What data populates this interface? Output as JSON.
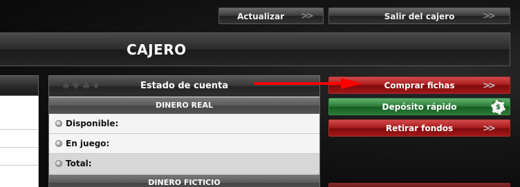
{
  "header": {
    "refresh_label": "Actualizar",
    "exit_label": "Salir del cajero",
    "arrow_glyph": ">>"
  },
  "title_bar": {
    "title": "CAJERO"
  },
  "account": {
    "heading": "Estado de cuenta",
    "heading_decoration": "♠♥♣♦",
    "real_money_section": "DINERO REAL",
    "rows": [
      {
        "label": "Disponible:"
      },
      {
        "label": "En juego:"
      },
      {
        "label": "Total:"
      }
    ],
    "play_money_section": "DINERO FICTICIO"
  },
  "actions": {
    "buy_chips_label": "Comprar fichas",
    "quick_deposit_label": "Depósito rápido",
    "quick_deposit_chip_text": "$",
    "withdraw_label": "Retirar fondos",
    "arrow_glyph": ">>"
  },
  "colors": {
    "annotation_arrow": "#ff0000",
    "red_button": "#a81c1c",
    "green_button": "#2c7b38"
  }
}
